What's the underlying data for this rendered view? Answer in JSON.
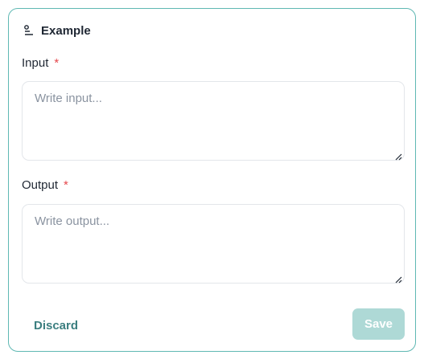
{
  "header": {
    "title": "Example",
    "icon": "text-align-left-icon"
  },
  "input_field": {
    "label": "Input",
    "required_mark": "*",
    "placeholder": "Write input...",
    "value": ""
  },
  "output_field": {
    "label": "Output",
    "required_mark": "*",
    "placeholder": "Write output...",
    "value": ""
  },
  "actions": {
    "discard_label": "Discard",
    "save_label": "Save",
    "save_enabled": false
  },
  "colors": {
    "border": "#5fb8b3",
    "required": "#e5484d",
    "discard_text": "#3c7f80",
    "save_background": "#aed9d6"
  }
}
